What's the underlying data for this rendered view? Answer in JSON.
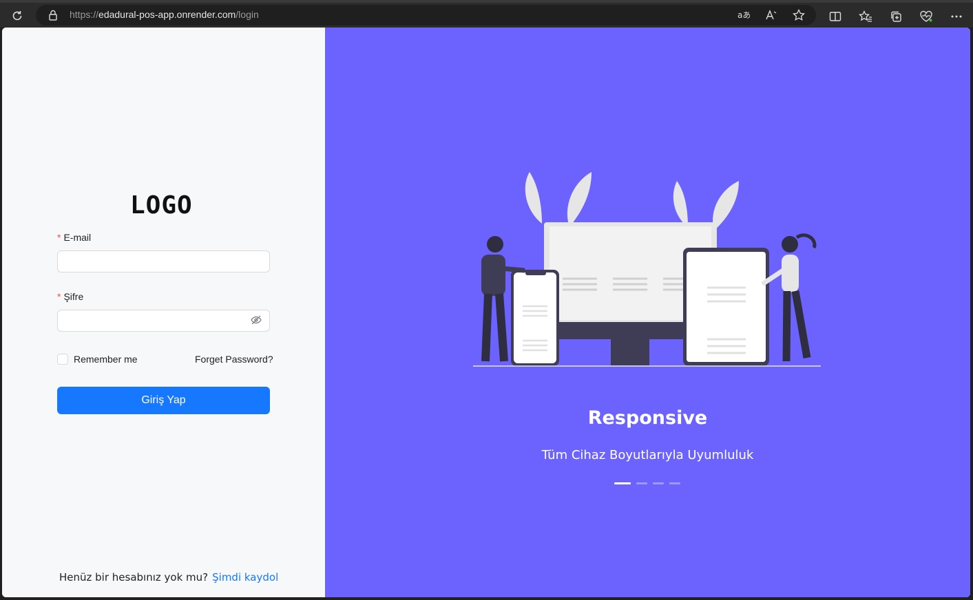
{
  "browser": {
    "url_scheme": "https://",
    "url_host": "edadural-pos-app.onrender.com",
    "url_path": "/login"
  },
  "login": {
    "logo": "LOGO",
    "email_label": "E-mail",
    "email_value": "",
    "password_label": "Şifre",
    "password_value": "",
    "remember_label": "Remember me",
    "forget_label": "Forget Password?",
    "submit_label": "Giriş Yap",
    "signup_question": "Henüz bir hesabınız yok mu?",
    "signup_link": "Şimdi kaydol",
    "required_mark": "*"
  },
  "carousel": {
    "title": "Responsive",
    "subtitle": "Tüm Cihaz Boyutlarıyla Uyumluluk",
    "slide_count": 4,
    "active_index": 0
  },
  "colors": {
    "primary": "#1677ff",
    "hero_bg": "#6c63ff",
    "required": "#ff4d4f"
  },
  "icons": [
    "reload-icon",
    "lock-icon",
    "translate-icon",
    "read-aloud-icon",
    "favorite-star-icon",
    "split-screen-icon",
    "favorites-icon",
    "collections-icon",
    "performance-icon",
    "more-icon",
    "eye-invisible-icon"
  ]
}
